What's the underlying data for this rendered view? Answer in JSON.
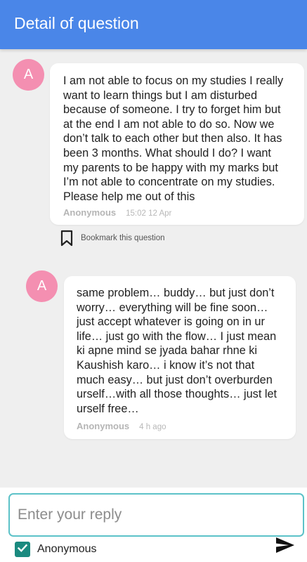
{
  "header": {
    "title": "Detail of question"
  },
  "question": {
    "avatar_letter": "A",
    "lines": [
      "I am not able to focus on my studies I really",
      "want to learn things but I am disturbed",
      "because of someone. I try to forget him but",
      "at the end I am not able to do so. Now we",
      "don’t talk to each other but then also. It has",
      "been 3 months. What should I do? I want",
      "my parents to be happy with my marks but",
      "I’m not able to concentrate on my studies.",
      "Please help me out of this"
    ],
    "author": "Anonymous",
    "time": "15:02 12 Apr"
  },
  "bookmark": {
    "icon": "bookmark-icon",
    "label": "Bookmark this question"
  },
  "answer": {
    "avatar_letter": "A",
    "lines": [
      "same problem… buddy… but just don’t",
      "worry… everything will be fine soon…",
      "just accept whatever is going on in ur",
      "life… just go with the flow… I just mean",
      "ki apne mind se jyada bahar rhne ki",
      "Kaushish karo… i know it’s not that",
      "much easy… but just don’t overburden",
      "urself…with all those thoughts… just let",
      "urself free…"
    ],
    "author": "Anonymous",
    "time": "4 h ago"
  },
  "reply": {
    "placeholder": "Enter your reply",
    "value": "",
    "anonymous_label": "Anonymous",
    "anonymous_checked": true,
    "send_icon": "send-icon"
  },
  "colors": {
    "app_bar": "#4a86e8",
    "avatar": "#f48fb1",
    "input_border": "#5cc2c8",
    "checkbox": "#1a8a7f",
    "background": "#efefef"
  }
}
